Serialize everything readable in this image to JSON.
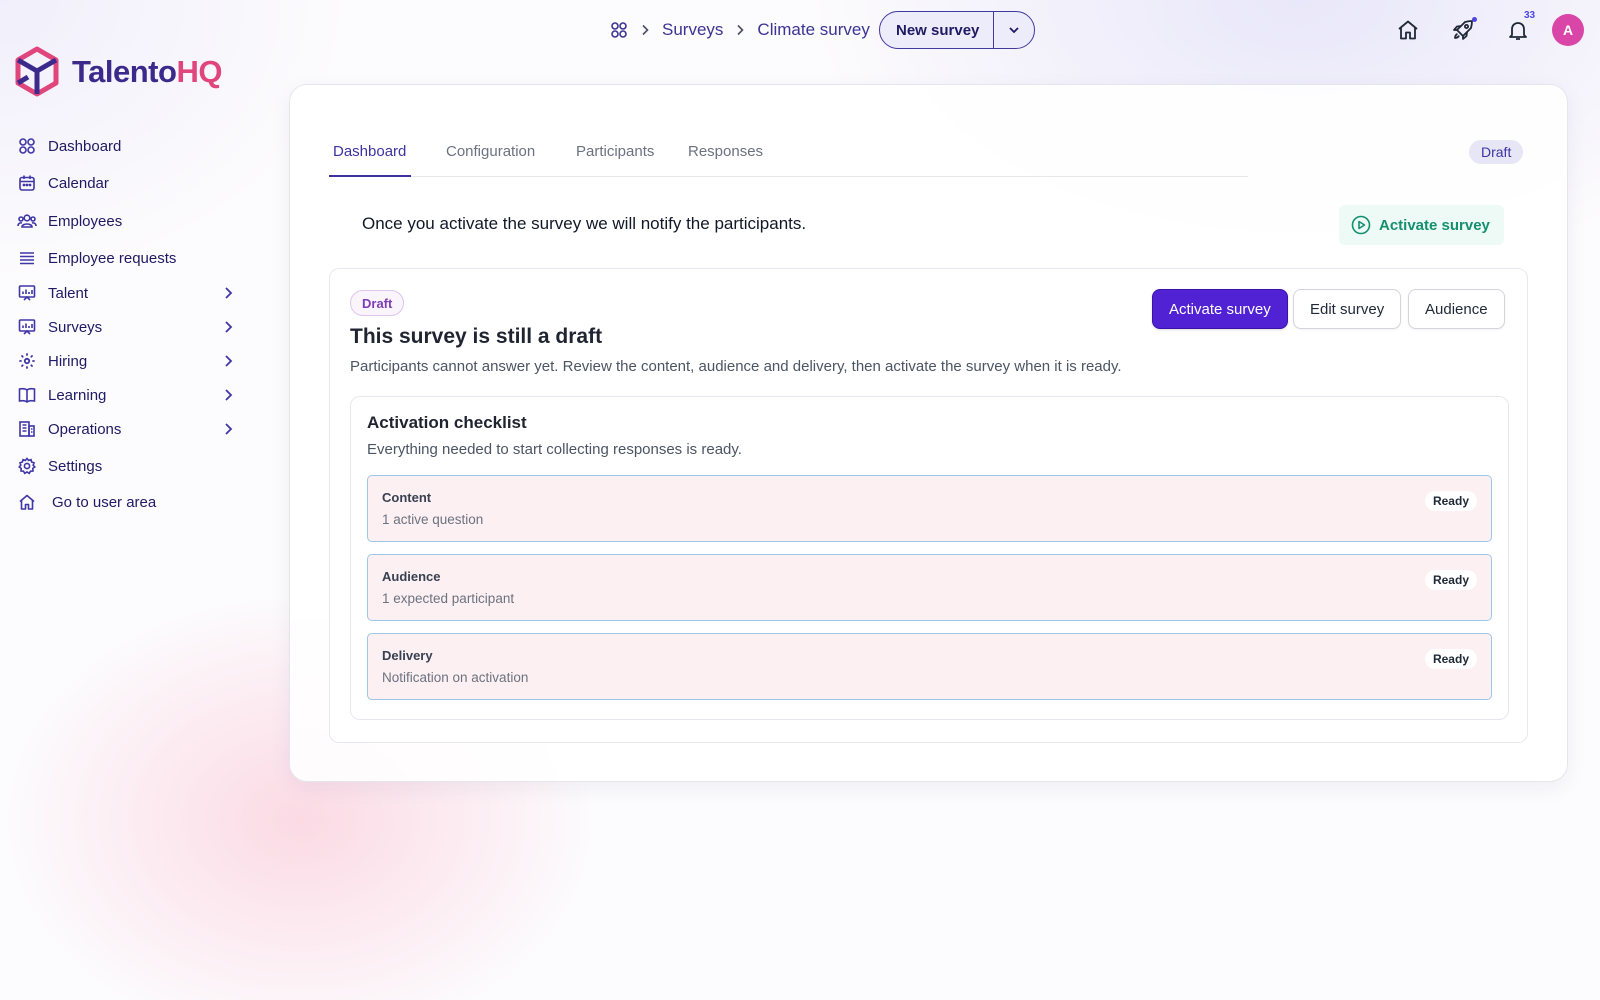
{
  "brand": {
    "name_part1": "Talento",
    "name_part2": "HQ",
    "primary_color": "#3b2a8c",
    "accent_color": "#e0457b"
  },
  "sidebar": {
    "items": [
      {
        "label": "Dashboard",
        "icon": "dashboard-icon"
      },
      {
        "label": "Calendar",
        "icon": "calendar-icon"
      },
      {
        "label": "Employees",
        "icon": "employees-icon"
      },
      {
        "label": "Employee requests",
        "icon": "list-icon"
      },
      {
        "label": "Talent",
        "icon": "chart-icon",
        "expandable": true
      },
      {
        "label": "Surveys",
        "icon": "chart-icon",
        "expandable": true
      },
      {
        "label": "Hiring",
        "icon": "hiring-icon",
        "expandable": true
      },
      {
        "label": "Learning",
        "icon": "book-icon",
        "expandable": true
      },
      {
        "label": "Operations",
        "icon": "building-icon",
        "expandable": true
      },
      {
        "label": "Settings",
        "icon": "gear-icon"
      },
      {
        "label": "Go to user area",
        "icon": "home-icon"
      }
    ]
  },
  "topbar": {
    "breadcrumb": [
      "Surveys",
      "Climate survey"
    ],
    "new_button": "New survey",
    "notification_count": "33",
    "avatar_initial": "A"
  },
  "tabs": [
    "Dashboard",
    "Configuration",
    "Participants",
    "Responses"
  ],
  "active_tab": "Dashboard",
  "status": "Draft",
  "notice": "Once you activate the survey we will notify the participants.",
  "activate_top_label": "Activate survey",
  "draft_card": {
    "badge": "Draft",
    "title": "This survey is still a draft",
    "subtitle": "Participants cannot answer yet. Review the content, audience and delivery, then activate the survey when it is ready.",
    "buttons": {
      "activate": "Activate survey",
      "edit": "Edit survey",
      "audience": "Audience"
    }
  },
  "checklist": {
    "title": "Activation checklist",
    "subtitle": "Everything needed to start collecting responses is ready.",
    "items": [
      {
        "name": "Content",
        "desc": "1 active question",
        "status": "Ready"
      },
      {
        "name": "Audience",
        "desc": "1 expected participant",
        "status": "Ready"
      },
      {
        "name": "Delivery",
        "desc": "Notification on activation",
        "status": "Ready"
      }
    ]
  }
}
